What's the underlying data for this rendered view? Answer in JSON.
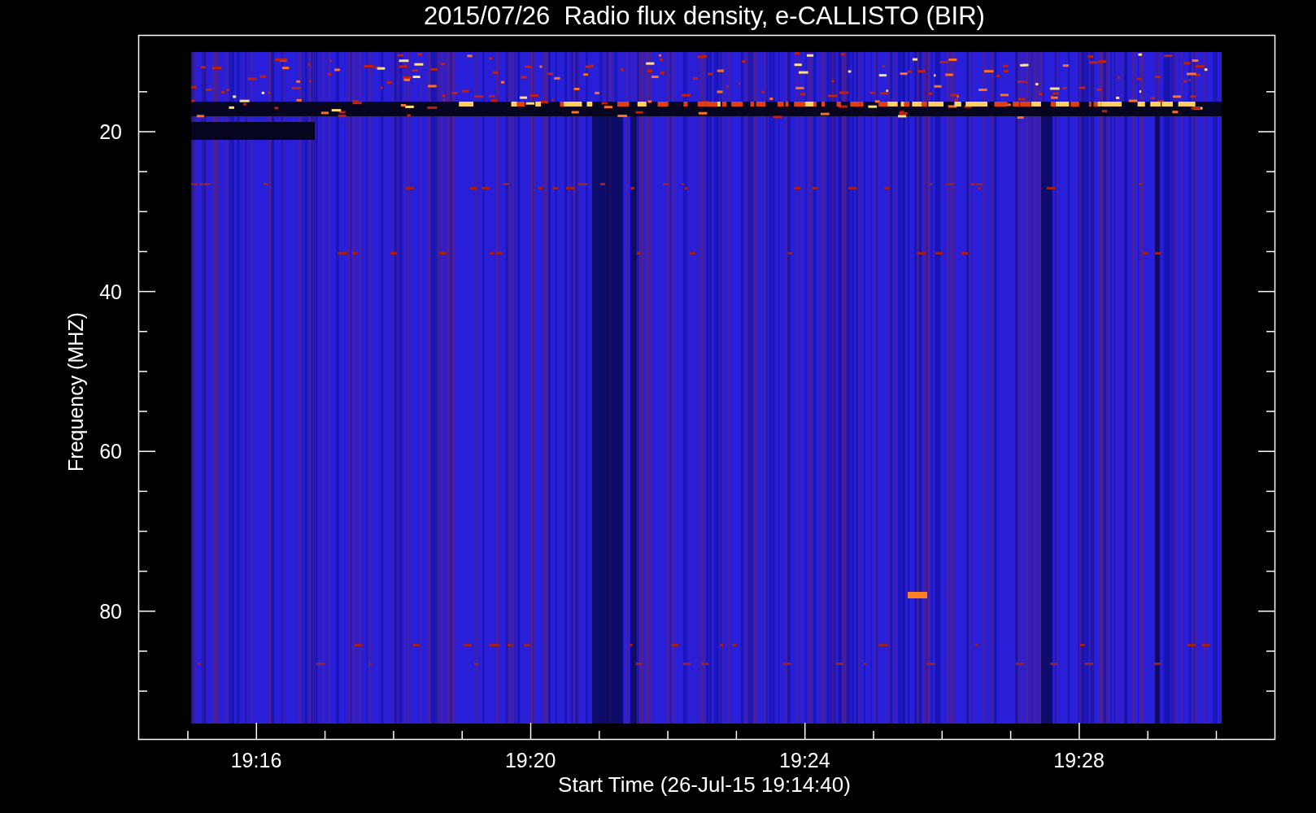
{
  "title": "2015/07/26  Radio flux density, e-CALLISTO (BIR)",
  "y_axis": {
    "label": "Frequency (MHZ)",
    "ticks": [
      "20",
      "40",
      "60",
      "80"
    ]
  },
  "x_axis": {
    "label": "Start Time (26-Jul-15 19:14:40)",
    "ticks": [
      "19:16",
      "19:20",
      "19:24",
      "19:28"
    ]
  }
}
